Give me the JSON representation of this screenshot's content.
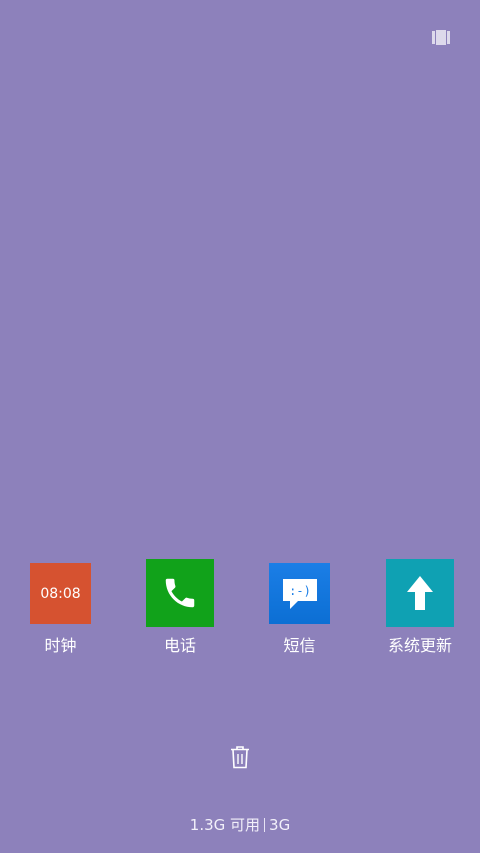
{
  "status": {
    "recents_icon": "multi-window-icon"
  },
  "apps": [
    {
      "label": "时钟",
      "tile_text": "08:08",
      "icon": "clock-icon",
      "color": "#d65230"
    },
    {
      "label": "电话",
      "icon": "phone-icon",
      "color": "#11a21a"
    },
    {
      "label": "短信",
      "icon": "message-icon",
      "glyph": ":-)",
      "color": "#1b7ee6"
    },
    {
      "label": "系统更新",
      "icon": "upload-arrow-icon",
      "color": "#0fa1b3"
    }
  ],
  "footer": {
    "clear_icon": "trash-icon",
    "memory_available": "1.3G 可用",
    "memory_total": "3G"
  },
  "colors": {
    "background": "#8d81bb"
  }
}
